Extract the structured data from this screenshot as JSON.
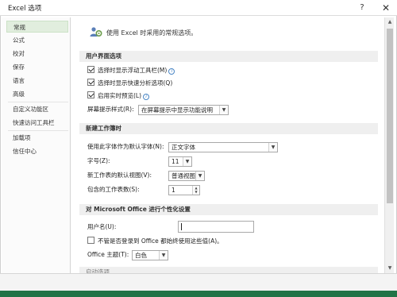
{
  "window": {
    "title": "Excel 选项",
    "help": "?",
    "close": "✕"
  },
  "sidebar": {
    "items": [
      {
        "label": "常规"
      },
      {
        "label": "公式"
      },
      {
        "label": "校对"
      },
      {
        "label": "保存"
      },
      {
        "label": "语言"
      },
      {
        "label": "高级"
      },
      {
        "label": "自定义功能区"
      },
      {
        "label": "快速访问工具栏"
      },
      {
        "label": "加载项"
      },
      {
        "label": "信任中心"
      }
    ]
  },
  "header": {
    "text": "使用 Excel 时采用的常规选项。"
  },
  "ui_options": {
    "title": "用户界面选项",
    "mini_toolbar": "选择时显示浮动工具栏(M)",
    "quick_analysis": "选择时显示快速分析选项(Q)",
    "live_preview": "启用实时预览(L)",
    "screentip_label": "屏幕提示样式(R):",
    "screentip_value": "在屏幕提示中显示功能说明"
  },
  "new_workbook": {
    "title": "新建工作簿时",
    "font_label": "使用此字体作为默认字体(N):",
    "font_value": "正文字体",
    "size_label": "字号(Z):",
    "size_value": "11",
    "view_label": "新工作表的默认视图(V):",
    "view_value": "普通视图",
    "sheets_label": "包含的工作表数(S):",
    "sheets_value": "1"
  },
  "personalize": {
    "title": "对 Microsoft Office 进行个性化设置",
    "username_label": "用户名(U):",
    "username_value": "",
    "always_use_label": "不管是否登录到 Office 都始终使用这些值(A)。",
    "theme_label": "Office 主题(T):",
    "theme_value": "白色"
  },
  "next_section_partial": "启动选项"
}
